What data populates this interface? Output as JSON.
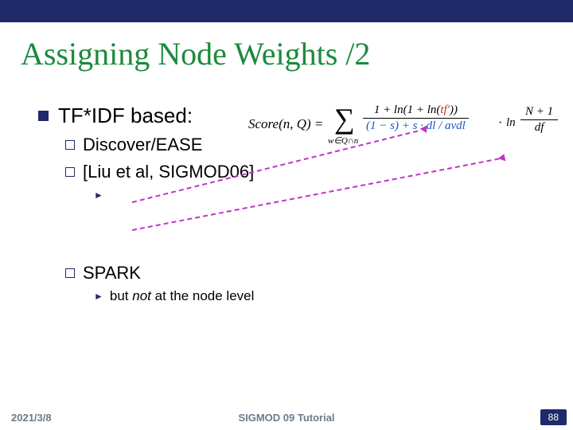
{
  "title": "Assigning Node Weights /2",
  "bullet1": "TF*IDF based:",
  "sub_a": "Discover/EASE",
  "sub_b": "[Liu et al, SIGMOD06]",
  "sub_c": "SPARK",
  "sub_c_note_prefix": "but ",
  "sub_c_note_italic": "not",
  "sub_c_note_suffix": " at the node level",
  "formula": {
    "lhs": "Score(n, Q) =",
    "sigma_sub": "w∈Q∩n",
    "frac1_num_a": "1 + ln(1 + ln(",
    "frac1_num_tf": "tf′",
    "frac1_num_b": "))",
    "frac1_den": "(1 − s) + s · dl / avdl",
    "ln": "ln",
    "frac2_num": "N + 1",
    "frac2_den": "df"
  },
  "footer": {
    "date": "2021/3/8",
    "center": "SIGMOD 09 Tutorial",
    "page": "88"
  }
}
